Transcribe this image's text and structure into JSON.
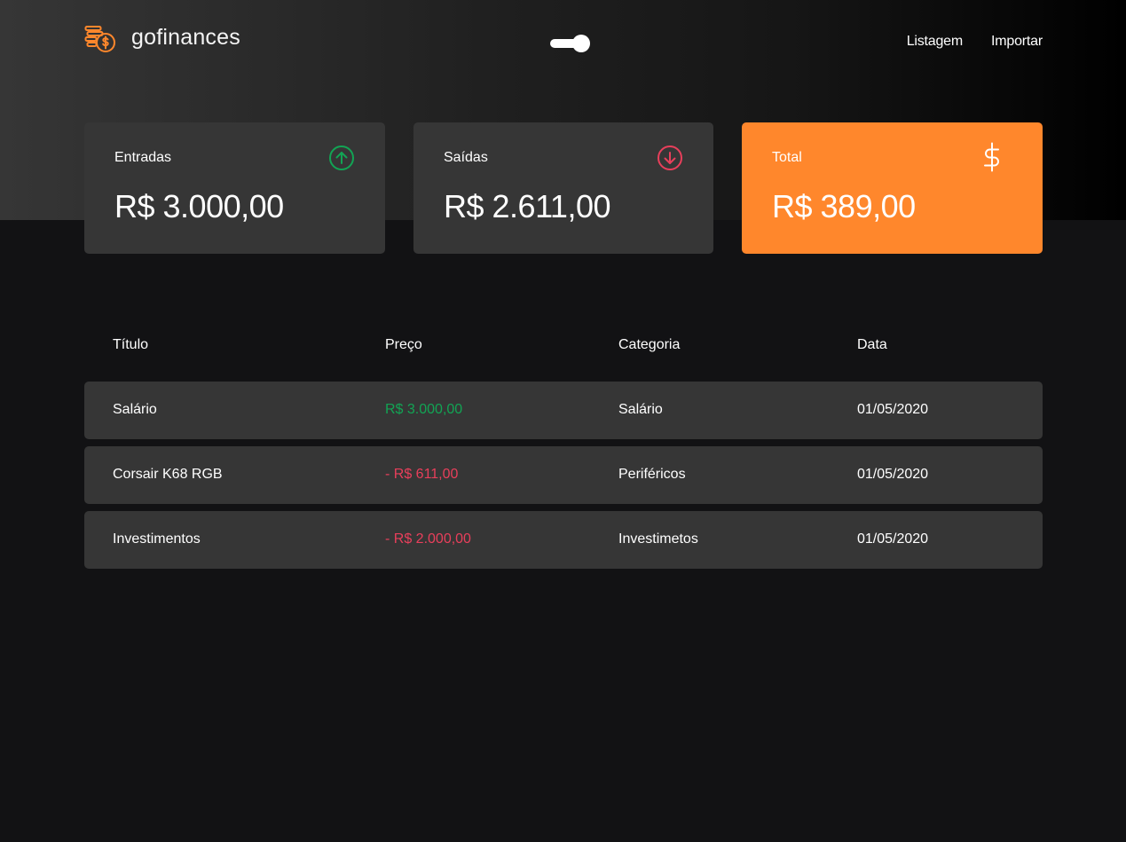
{
  "header": {
    "logo_text": "gofinances",
    "logo_icon": "coins-dollar-icon",
    "theme_toggle": {
      "state": "on"
    },
    "nav": [
      {
        "label": "Listagem"
      },
      {
        "label": "Importar"
      }
    ]
  },
  "cards": [
    {
      "label": "Entradas",
      "value": "R$ 3.000,00",
      "icon": "arrow-up-circle-icon",
      "icon_color": "#12a454"
    },
    {
      "label": "Saídas",
      "value": "R$ 2.611,00",
      "icon": "arrow-down-circle-icon",
      "icon_color": "#e83f5b"
    },
    {
      "label": "Total",
      "value": "R$ 389,00",
      "icon": "dollar-sign-icon",
      "background": "#ff872c"
    }
  ],
  "table": {
    "headers": [
      "Título",
      "Preço",
      "Categoria",
      "Data"
    ],
    "rows": [
      {
        "title": "Salário",
        "price": "R$ 3.000,00",
        "type": "income",
        "category": "Salário",
        "date": "01/05/2020"
      },
      {
        "title": "Corsair K68 RGB",
        "price": "- R$ 611,00",
        "type": "outcome",
        "category": "Periféricos",
        "date": "01/05/2020"
      },
      {
        "title": "Investimentos",
        "price": "- R$ 2.000,00",
        "type": "outcome",
        "category": "Investimetos",
        "date": "01/05/2020"
      }
    ]
  },
  "colors": {
    "accent": "#ff872c",
    "income": "#12a454",
    "outcome": "#e83f5b",
    "background": "#121214",
    "card": "#363636"
  }
}
